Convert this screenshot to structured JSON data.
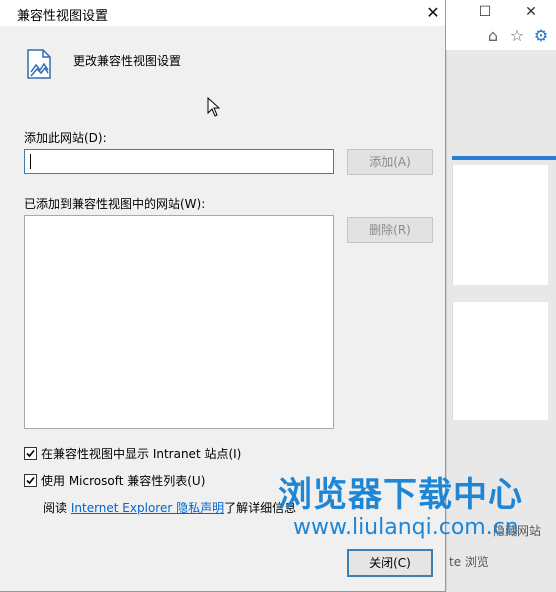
{
  "dialog": {
    "title": "兼容性视图设置",
    "header_text": "更改兼容性视图设置",
    "add_site_label": "添加此网站(D):",
    "add_site_value": "",
    "add_button": "添加(A)",
    "added_list_label": "已添加到兼容性视图中的网站(W):",
    "added_sites": [],
    "remove_button": "删除(R)",
    "checkbox_intranet": {
      "label": "在兼容性视图中显示 Intranet 站点(I)",
      "checked": true
    },
    "checkbox_mslist": {
      "label": "使用 Microsoft 兼容性列表(U)",
      "checked": true
    },
    "info_prefix": "阅读",
    "info_link": "Internet Explorer 隐私声明",
    "info_suffix": "了解详细信息",
    "close_button": "关闭(C)"
  },
  "background": {
    "side_text_1": "隐藏网站",
    "side_text_2": "te 浏览"
  },
  "watermark": {
    "title": "浏览器下载中心",
    "url": "www.liulanqi.com.cn"
  },
  "colors": {
    "accent": "#3c7fb1",
    "link": "#0066cc",
    "watermark": "#1f86d6"
  }
}
